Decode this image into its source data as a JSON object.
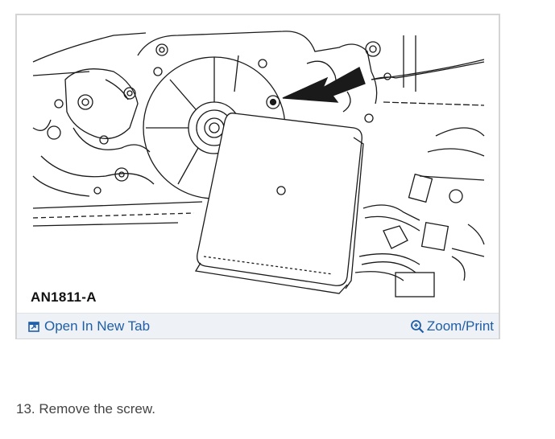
{
  "figure": {
    "code": "AN1811-A",
    "open_tab_label": "Open In New Tab",
    "zoom_label": "Zoom/Print",
    "open_tab_icon": "open-in-new-tab-icon",
    "zoom_icon": "zoom-in-icon",
    "link_color": "#1f5fa8",
    "toolbar_bg": "#eef1f5"
  },
  "instruction": {
    "text": "13. Remove the screw."
  }
}
